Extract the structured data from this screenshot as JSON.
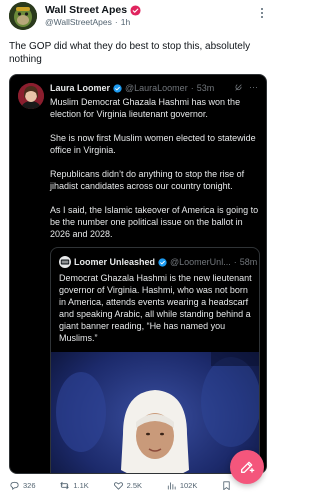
{
  "post": {
    "author_name": "Wall Street Apes",
    "author_handle": "@WallStreetApes",
    "dot": "·",
    "time": "1h",
    "text": "The GOP did what they do best to stop this, absolutely nothing"
  },
  "quote": {
    "author_name": "Laura Loomer",
    "author_handle": "@LauraLoomer",
    "dot": "·",
    "time": "53m",
    "paragraphs": [
      "Muslim Democrat Ghazala Hashmi has won the election for Virginia lieutenant governor.",
      "She is now first Muslim women elected to statewide office in Virginia.",
      "Republicans didn’t do anything to stop the rise of jihadist candidates across our country tonight.",
      "As I said, the Islamic takeover of America is going to be the number one political issue on the ballot in 2026 and 2028."
    ]
  },
  "nested_quote": {
    "author_name": "Loomer Unleashed",
    "author_handle": "@LoomerUnl...",
    "dot": "·",
    "time": "58m",
    "text": "Democrat Ghazala Hashmi is the new lieutenant governor of Virginia. Hashmi, who was not born in America, attends events wearing a headscarf and speaking Arabic, all while standing behind a giant banner reading, “He has named you Muslims.”"
  },
  "actions": {
    "replies": "326",
    "reposts": "1.1K",
    "likes": "2.5K",
    "views": "102K"
  },
  "icons": {
    "verified": "verified-badge-icon",
    "more": "more-dots-icon",
    "grok": "grok-icon",
    "reply": "reply-icon",
    "repost": "repost-icon",
    "like": "heart-icon",
    "views": "views-icon",
    "bookmark": "bookmark-icon",
    "share": "share-icon",
    "compose": "compose-icon"
  },
  "colors": {
    "compose_fab": "#f4567c",
    "verified_red": "#e0245e",
    "verified_blue": "#1d9bf0",
    "quote_bg": "#000000",
    "muted_text": "#536471"
  }
}
